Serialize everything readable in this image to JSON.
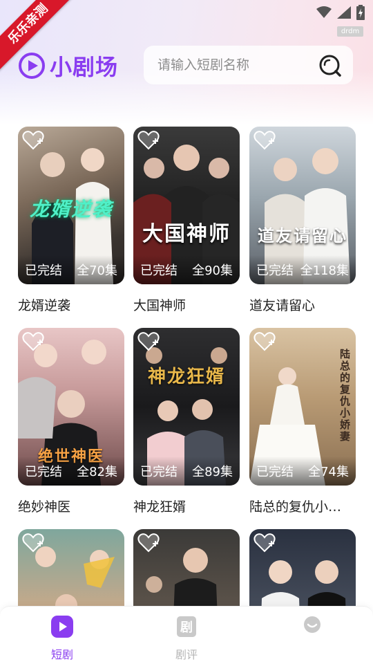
{
  "ribbon": {
    "text": "乐乐亲测"
  },
  "status_badge": "drdm",
  "app": {
    "logo_text": "小剧场"
  },
  "search": {
    "placeholder": "请输入短剧名称"
  },
  "colors": {
    "accent": "#8a3df0",
    "ribbon": "#d8182a"
  },
  "dramas": [
    {
      "title": "龙婿逆袭",
      "status": "已完结",
      "episodes": "全70集",
      "poster_text": "龙婿逆袭"
    },
    {
      "title": "大国神师",
      "status": "已完结",
      "episodes": "全90集",
      "poster_text": "大国神师"
    },
    {
      "title": "道友请留心",
      "status": "已完结",
      "episodes": "全118集",
      "poster_text": "道友请留心"
    },
    {
      "title": "绝妙神医",
      "status": "已完结",
      "episodes": "全82集",
      "poster_text": "绝世神医"
    },
    {
      "title": "神龙狂婿",
      "status": "已完结",
      "episodes": "全89集",
      "poster_text": "神龙狂婿"
    },
    {
      "title": "陆总的复仇小…",
      "status": "已完结",
      "episodes": "全74集",
      "poster_text": "陆总的复仇小娇妻"
    },
    {
      "title": "",
      "status": "",
      "episodes": "",
      "poster_text": ""
    },
    {
      "title": "",
      "status": "",
      "episodes": "",
      "poster_text": ""
    },
    {
      "title": "",
      "status": "",
      "episodes": "",
      "poster_text": ""
    }
  ],
  "tabbar": {
    "items": [
      {
        "label": "短剧",
        "icon": "play-icon",
        "active": true
      },
      {
        "label": "剧评",
        "icon": "drama-review-icon",
        "active": false
      },
      {
        "label": "",
        "icon": "profile-icon",
        "active": false
      }
    ]
  }
}
